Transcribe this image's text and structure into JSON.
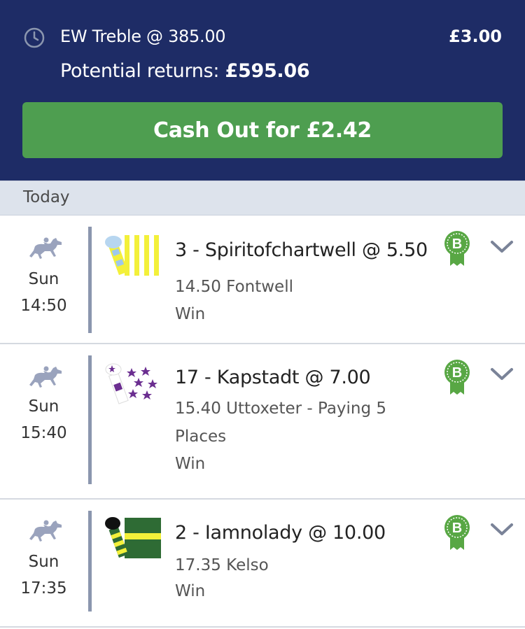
{
  "header": {
    "bet_title": "EW Treble @ 385.00",
    "stake": "£3.00",
    "returns_label": "Potential returns:",
    "returns_value": "£595.06",
    "cashout_label": "Cash Out for £2.42",
    "icon": "clock-icon"
  },
  "section": {
    "label": "Today"
  },
  "selections": [
    {
      "day": "Sun",
      "time": "14:50",
      "name": "3 - Spiritofchartwell @ 5.50",
      "race": "14.50 Fontwell",
      "market": "Win",
      "badge": "B"
    },
    {
      "day": "Sun",
      "time": "15:40",
      "name": "17 - Kapstadt @ 7.00",
      "race": "15.40 Uttoxeter - Paying 5 Places",
      "market": "Win",
      "badge": "B"
    },
    {
      "day": "Sun",
      "time": "17:35",
      "name": "2 - Iamnolady @ 10.00",
      "race": "17.35 Kelso",
      "market": "Win",
      "badge": "B"
    }
  ],
  "colors": {
    "header_bg": "#1e2c66",
    "cashout_bg": "#4e9e50",
    "badge": "#58a744",
    "section_bg": "#dde3ec"
  }
}
